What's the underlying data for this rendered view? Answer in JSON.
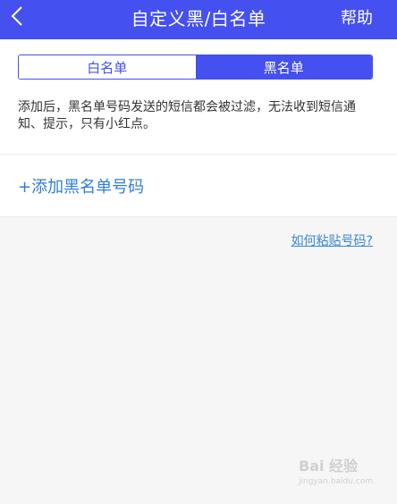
{
  "header": {
    "title": "自定义黑/白名单",
    "help_label": "帮助"
  },
  "tabs": [
    {
      "label": "白名单",
      "selected": false
    },
    {
      "label": "黑名单",
      "selected": true
    }
  ],
  "description": "添加后，黑名单号码发送的短信都会被过滤，无法收到短信通知、提示，只有小红点。",
  "add_button_label": "+添加黑名单号码",
  "paste_help_link": "如何粘贴号码?",
  "watermark": {
    "brand": "Bai 经验",
    "url": "jingyan.baidu.com"
  },
  "colors": {
    "accent": "#4450f0",
    "link": "#2e7fd6"
  }
}
